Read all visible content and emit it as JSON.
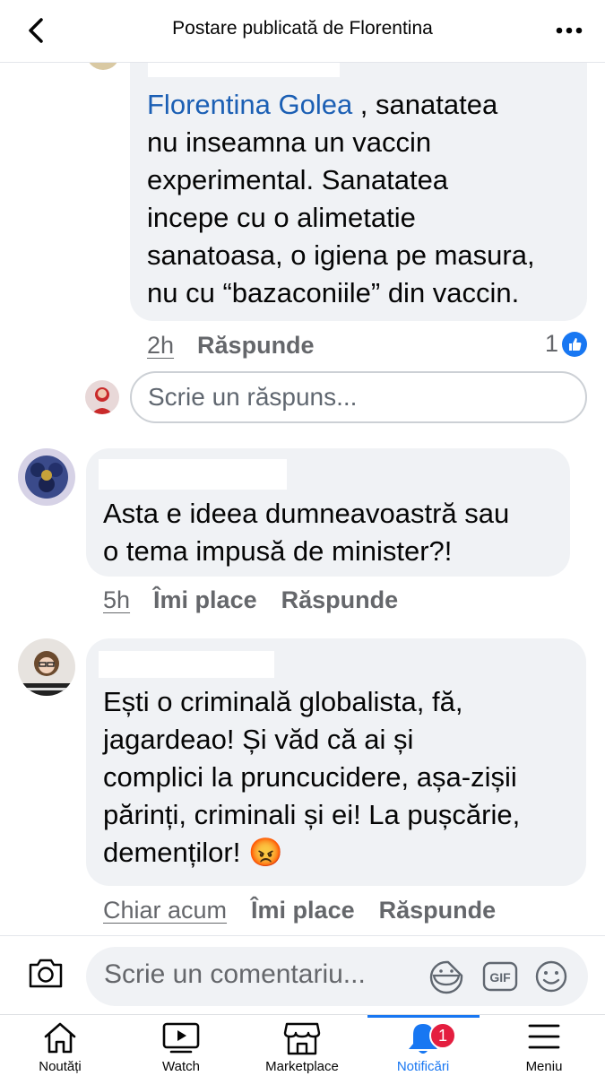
{
  "header": {
    "title": "Postare publicată de Florentina"
  },
  "comments": [
    {
      "mention": "Florentina Golea",
      "text": " , sanatatea\nnu inseamna un vaccin\nexperimental. Sanatatea\nincepe cu o alimetatie\nsanatoasa, o igiena pe masura,\nnu cu “bazaconiile” din vaccin.",
      "time": "2h",
      "reply_label": "Răspunde",
      "like_count": "1"
    },
    {
      "text": "Asta e ideea dumneavoastră sau\no tema impusă de minister?!",
      "time": "5h",
      "like_label": "Îmi place",
      "reply_label": "Răspunde"
    },
    {
      "text": "Ești o criminală globalista,  fă,\njagardeao!  Și văd că ai și\ncomplici la pruncucidere, așa-zișii\npărinți,  criminali și ei! La pușcărie,\ndemenților! ",
      "emoji": "😡",
      "time": "Chiar acum",
      "like_label": "Îmi place",
      "reply_label": "Răspunde"
    }
  ],
  "reply_box": {
    "placeholder": "Scrie un răspuns..."
  },
  "comment_bar": {
    "placeholder": "Scrie un comentariu...",
    "gif_label": "GIF"
  },
  "tabs": [
    {
      "label": "Noutăți",
      "icon": "home-icon"
    },
    {
      "label": "Watch",
      "icon": "video-icon"
    },
    {
      "label": "Marketplace",
      "icon": "store-icon"
    },
    {
      "label": "Notificări",
      "icon": "bell-icon",
      "badge": "1",
      "active": true
    },
    {
      "label": "Meniu",
      "icon": "menu-icon"
    }
  ],
  "colors": {
    "accent": "#1877f2",
    "bubble": "#f0f2f5",
    "mention": "#1b5fb4",
    "secondary_text": "#65676b",
    "badge": "#e41e3f"
  }
}
